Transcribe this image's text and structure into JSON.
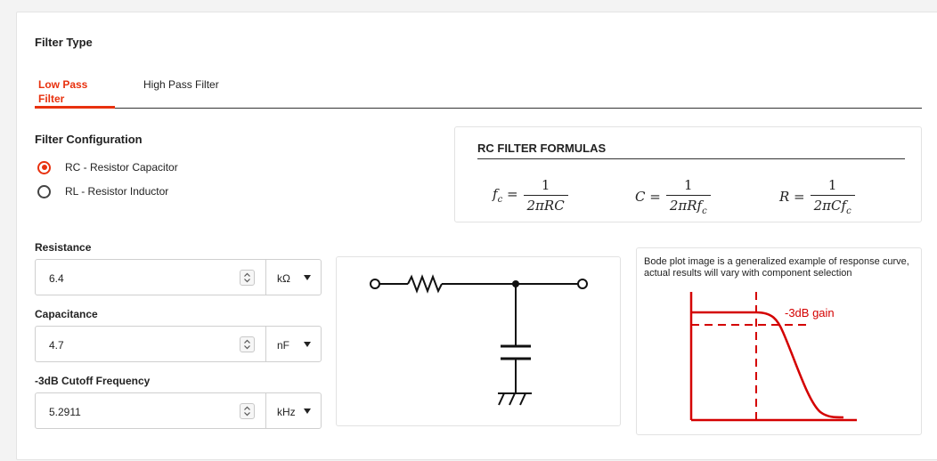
{
  "filter_type": {
    "heading": "Filter Type",
    "tabs": [
      {
        "label": "Low Pass Filter",
        "active": true
      },
      {
        "label": "High Pass Filter",
        "active": false
      }
    ]
  },
  "config": {
    "heading": "Filter Configuration",
    "options": [
      {
        "label": "RC - Resistor Capacitor",
        "selected": true
      },
      {
        "label": "RL - Resistor Inductor",
        "selected": false
      }
    ]
  },
  "formulas": {
    "title": "RC FILTER FORMULAS",
    "items": [
      {
        "lhs": "fc =",
        "numerator": "1",
        "denominator": "2πRC"
      },
      {
        "lhs": "C =",
        "numerator": "1",
        "denominator": "2πRfc"
      },
      {
        "lhs": "R =",
        "numerator": "1",
        "denominator": "2πCfc"
      }
    ]
  },
  "fields": {
    "resistance": {
      "label": "Resistance",
      "value": "6.4",
      "unit": "kΩ"
    },
    "capacitance": {
      "label": "Capacitance",
      "value": "4.7",
      "unit": "nF"
    },
    "cutoff": {
      "label": "-3dB Cutoff Frequency",
      "value": "5.2911",
      "unit": "kHz"
    }
  },
  "bode": {
    "note": "Bode plot image is a generalized example of response curve, actual results will vary with component selection",
    "gain_label": "-3dB gain"
  },
  "colors": {
    "accent": "#e8310e",
    "plot_red": "#d40000"
  }
}
